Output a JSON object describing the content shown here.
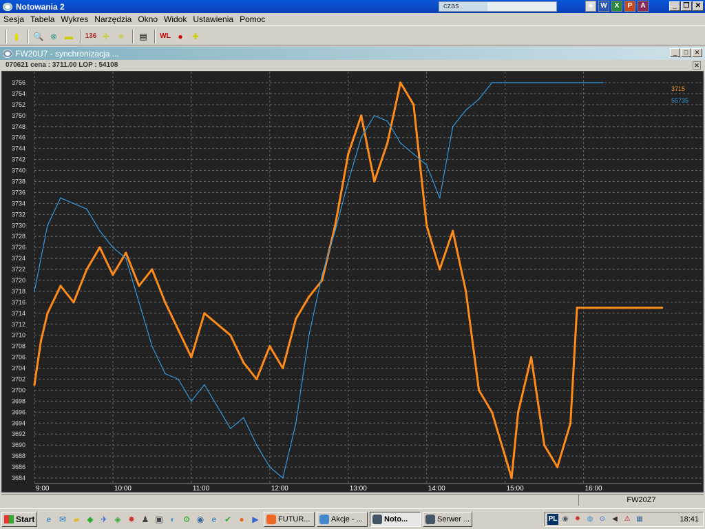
{
  "window": {
    "title": "Notowania 2",
    "czas_label": "czas"
  },
  "menu": [
    "Sesja",
    "Tabela",
    "Wykres",
    "Narzędzia",
    "Okno",
    "Widok",
    "Ustawienia",
    "Pomoc"
  ],
  "child_window": {
    "title": "FW20U7 - synchronizacja ..."
  },
  "infobar": {
    "text": "070621  cena : 3711.00 LOP : 54108"
  },
  "status": {
    "instrument": "FW20Z7"
  },
  "taskbar": {
    "start_label": "Start",
    "buttons": [
      "FUTUR...",
      "Akcje - ...",
      "Noto...",
      "Serwer ..."
    ],
    "tray_lang": "PL",
    "clock": "18:41"
  },
  "colors": {
    "price": "#ff8c1a",
    "lop": "#3399dd",
    "background": "#222222",
    "grid": "#666666"
  },
  "chart_data": {
    "type": "line",
    "y_ticks": [
      "3756",
      "3754",
      "3752",
      "3750",
      "3748",
      "3746",
      "3744",
      "3742",
      "3740",
      "3738",
      "3736",
      "3734",
      "3732",
      "3730",
      "3728",
      "3726",
      "3724",
      "3722",
      "3720",
      "3718",
      "3716",
      "3714",
      "3712",
      "3710",
      "3708",
      "3706",
      "3704",
      "3702",
      "3700",
      "3698",
      "3696",
      "3694",
      "3692",
      "3690",
      "3688",
      "3686",
      "3684"
    ],
    "ylim": [
      3683,
      3757
    ],
    "x_ticks": [
      "9:00",
      "10:00",
      "11:00",
      "12:00",
      "13:00",
      "14:00",
      "15:00",
      "16:00"
    ],
    "grid": true,
    "legend": {
      "position": "top-right",
      "labels": [
        "3715",
        "55735"
      ]
    },
    "series": [
      {
        "x": [
          "9:00",
          "9:05",
          "9:10",
          "9:20",
          "9:30",
          "9:40",
          "9:50",
          "10:00",
          "10:10",
          "10:20",
          "10:30",
          "10:40",
          "10:50",
          "11:00",
          "11:10",
          "11:20",
          "11:30",
          "11:40",
          "11:50",
          "12:00",
          "12:10",
          "12:20",
          "12:30",
          "12:40",
          "12:50",
          "13:00",
          "13:10",
          "13:20",
          "13:30",
          "13:40",
          "13:50",
          "14:00",
          "14:10",
          "14:20",
          "14:30",
          "14:40",
          "14:50",
          "15:00",
          "15:05",
          "15:10",
          "15:20",
          "15:30",
          "15:40",
          "15:50",
          "15:55",
          "16:00",
          "16:05",
          "16:10",
          "16:20",
          "16:30",
          "16:40",
          "16:50",
          "17:00"
        ],
        "values": [
          3701,
          3709,
          3714,
          3719,
          3716,
          3722,
          3726,
          3721,
          3725,
          3719,
          3722,
          3716,
          3711,
          3706,
          3714,
          3712,
          3710,
          3705,
          3702,
          3708,
          3704,
          3713,
          3717,
          3720,
          3730,
          3743,
          3750,
          3738,
          3745,
          3756,
          3752,
          3730,
          3722,
          3729,
          3718,
          3700,
          3696,
          3688,
          3684,
          3696,
          3706,
          3690,
          3686,
          3694,
          3715,
          3715,
          3715,
          3715,
          3715,
          3715,
          3715,
          3715,
          3715
        ]
      },
      {
        "x": [
          "9:00",
          "9:10",
          "9:20",
          "9:30",
          "9:40",
          "9:50",
          "10:00",
          "10:10",
          "10:20",
          "10:30",
          "10:40",
          "10:50",
          "11:00",
          "11:10",
          "11:20",
          "11:30",
          "11:40",
          "11:50",
          "12:00",
          "12:10",
          "12:20",
          "12:30",
          "12:40",
          "12:50",
          "13:00",
          "13:10",
          "13:20",
          "13:30",
          "13:40",
          "13:50",
          "14:00",
          "14:10",
          "14:20",
          "14:30",
          "14:40",
          "14:50",
          "15:00",
          "15:10",
          "15:20",
          "15:30",
          "15:40",
          "15:50",
          "16:00",
          "16:05",
          "16:10",
          "16:15"
        ],
        "values": [
          3718,
          3730,
          3735,
          3734,
          3733,
          3729,
          3726,
          3724,
          3716,
          3708,
          3703,
          3702,
          3698,
          3701,
          3697,
          3693,
          3695,
          3690,
          3686,
          3684,
          3694,
          3710,
          3721,
          3729,
          3738,
          3746,
          3750,
          3749,
          3745,
          3743,
          3741,
          3735,
          3748,
          3751,
          3753,
          3756,
          3756,
          3756,
          3756,
          3756,
          3756,
          3756,
          3756,
          3756,
          3756,
          3756
        ]
      }
    ]
  }
}
